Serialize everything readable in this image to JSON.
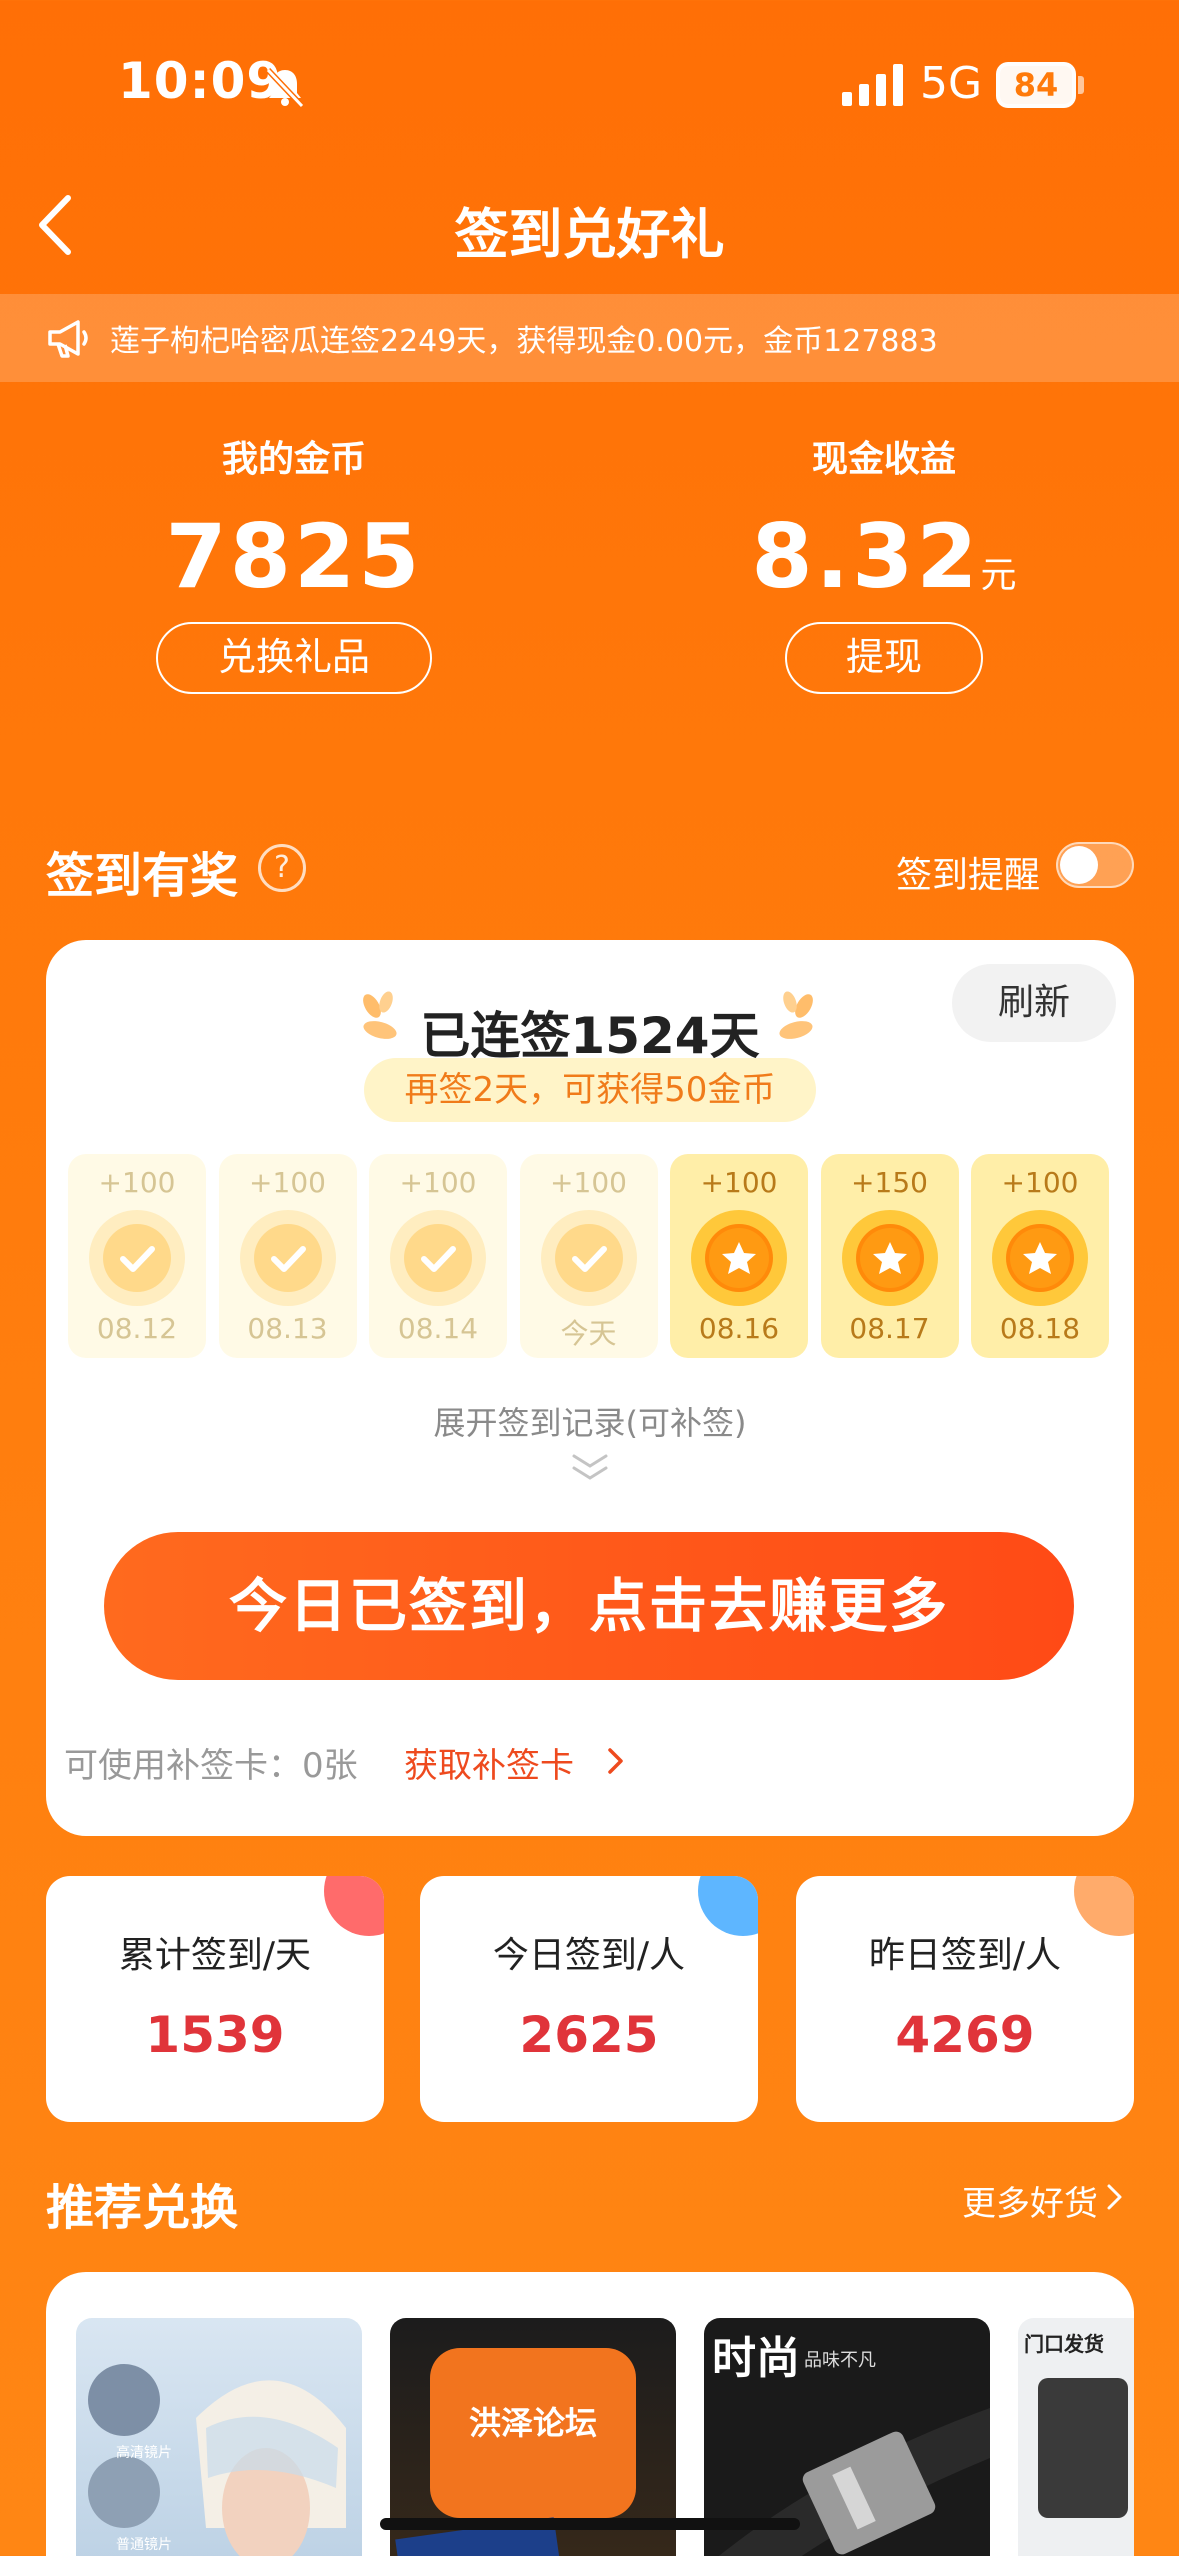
{
  "status_bar": {
    "time": "10:09",
    "network": "5G",
    "battery": "84"
  },
  "header": {
    "title": "签到兑好礼"
  },
  "marquee": {
    "text": "莲子枸杞哈密瓜连签2249天，获得现金0.00元，金币127883"
  },
  "assets": {
    "coins": {
      "label": "我的金币",
      "value": "7825",
      "button": "兑换礼品"
    },
    "cash": {
      "label": "现金收益",
      "value": "8.32",
      "unit": "元",
      "button": "提现"
    }
  },
  "checkin": {
    "title": "签到有奖",
    "help": "?",
    "reminder_label": "签到提醒",
    "reminder_on": false,
    "streak_text": "已连签1524天",
    "refresh_label": "刷新",
    "tip": "再签2天，可获得50金币",
    "days": [
      {
        "reward": "+100",
        "date": "08.12",
        "state": "done"
      },
      {
        "reward": "+100",
        "date": "08.13",
        "state": "done"
      },
      {
        "reward": "+100",
        "date": "08.14",
        "state": "done"
      },
      {
        "reward": "+100",
        "date": "今天",
        "state": "done"
      },
      {
        "reward": "+100",
        "date": "08.16",
        "state": "upcoming"
      },
      {
        "reward": "+150",
        "date": "08.17",
        "state": "upcoming"
      },
      {
        "reward": "+100",
        "date": "08.18",
        "state": "upcoming"
      }
    ],
    "expand_label": "展开签到记录(可补签)",
    "cta_label": "今日已签到，点击去赚更多",
    "makeup_cards": "可使用补签卡：0张",
    "get_card_link": "获取补签卡"
  },
  "stats": [
    {
      "label": "累计签到/天",
      "value": "1539",
      "accent": "#ff6b6b"
    },
    {
      "label": "今日签到/人",
      "value": "2625",
      "accent": "#5eb6ff"
    },
    {
      "label": "昨日签到/人",
      "value": "4269",
      "accent": "#ffab6b"
    }
  ],
  "recommend": {
    "title": "推荐兑换",
    "more_label": "更多好货",
    "products": [
      {
        "name": "helmet",
        "caption_top": "高清镜片",
        "caption_bottom": "普通镜片"
      },
      {
        "name": "speaker",
        "text": "洪泽论坛"
      },
      {
        "name": "belt",
        "title": "时尚",
        "subtitle": "品味不凡"
      },
      {
        "name": "organizer",
        "text": "门口发货"
      }
    ]
  },
  "colors": {
    "brand": "#ff7a0a",
    "accent_red": "#e0343a",
    "cta": "#ff5a1a",
    "link": "#ee4a1e"
  }
}
